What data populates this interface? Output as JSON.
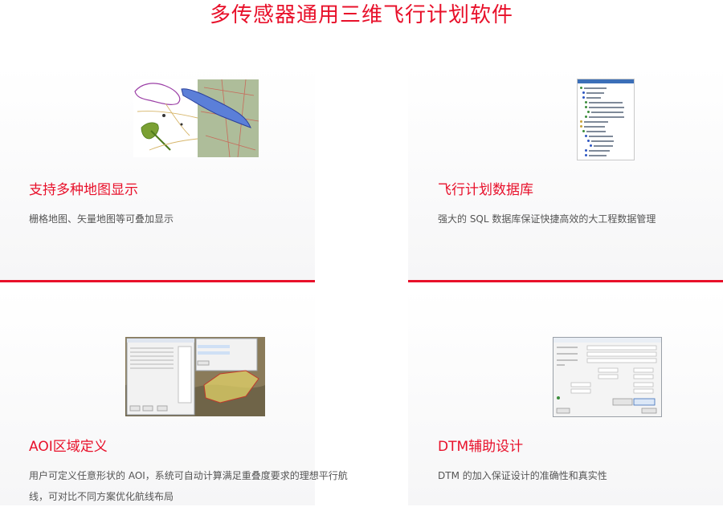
{
  "page": {
    "title": "多传感器通用三维飞行计划软件"
  },
  "cards": [
    {
      "title": "支持多种地图显示",
      "desc": "栅格地图、矢量地图等可叠加显示",
      "image_icon": "map-overlay-screenshot"
    },
    {
      "title": "飞行计划数据库",
      "desc": "强大的 SQL 数据库保证快捷高效的大工程数据管理",
      "image_icon": "database-tree-screenshot"
    },
    {
      "title": "AOI区域定义",
      "desc": "用户可定义任意形状的 AOI，系统可自动计算满足重叠度要求的理想平行航线，可对比不同方案优化航线布局",
      "image_icon": "aoi-dialog-screenshot"
    },
    {
      "title": "DTM辅助设计",
      "desc": "DTM 的加入保证设计的准确性和真实性",
      "image_icon": "dtm-dialog-screenshot"
    }
  ],
  "colors": {
    "accent": "#e8102a",
    "text": "#555555"
  }
}
